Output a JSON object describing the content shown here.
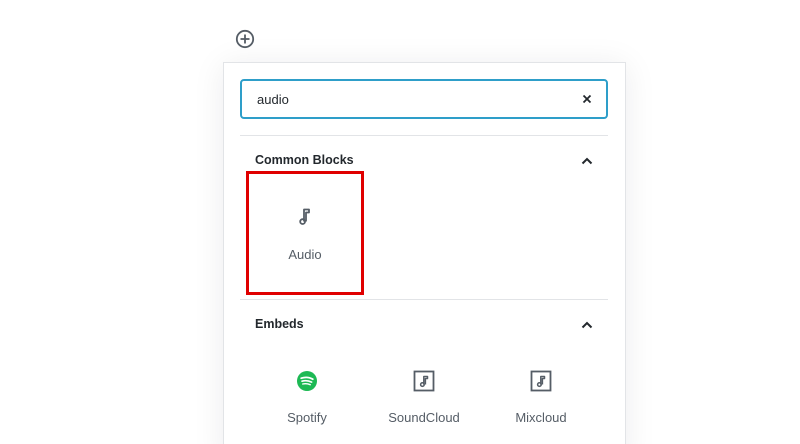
{
  "inserter": {
    "toggle_icon": "plus-circle-icon"
  },
  "search": {
    "value": "audio",
    "placeholder": "Search for a block",
    "clear_icon": "close-icon"
  },
  "panels": [
    {
      "title": "Common Blocks",
      "expanded": true,
      "chevron_icon": "chevron-up-icon",
      "items": [
        {
          "label": "Audio",
          "icon": "music-note-icon",
          "highlighted": true
        }
      ]
    },
    {
      "title": "Embeds",
      "expanded": true,
      "chevron_icon": "chevron-up-icon",
      "items": [
        {
          "label": "Spotify",
          "icon": "spotify-icon"
        },
        {
          "label": "SoundCloud",
          "icon": "embed-audio-icon"
        },
        {
          "label": "Mixcloud",
          "icon": "embed-audio-icon"
        }
      ]
    }
  ],
  "colors": {
    "search_border": "#2e9ec9",
    "highlight": "#e00000",
    "spotify": "#1db954",
    "icon": "#555d66"
  }
}
